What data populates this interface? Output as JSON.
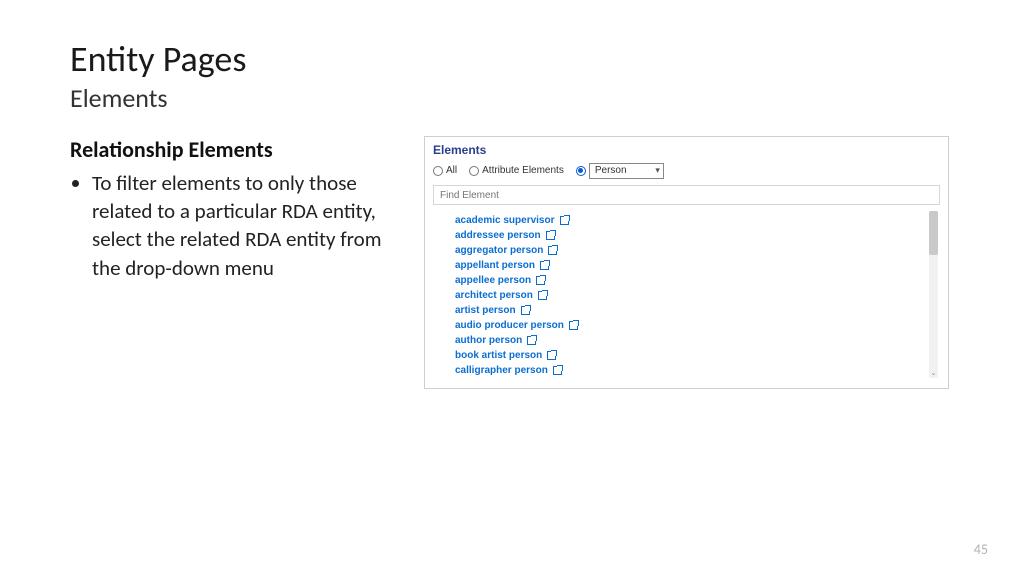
{
  "title": "Entity Pages",
  "subtitle": "Elements",
  "section_heading": "Relationship Elements",
  "bullet": "To filter elements to only those related to a particular RDA entity, select the related RDA entity from the drop-down menu",
  "panel": {
    "title": "Elements",
    "radios": {
      "all": "All",
      "attribute": "Attribute Elements"
    },
    "dropdown_value": "Person",
    "search_placeholder": "Find Element",
    "items": [
      "academic supervisor",
      "addressee person",
      "aggregator person",
      "appellant person",
      "appellee person",
      "architect person",
      "artist person",
      "audio producer person",
      "author person",
      "book artist person",
      "calligrapher person"
    ]
  },
  "page_number": "45"
}
